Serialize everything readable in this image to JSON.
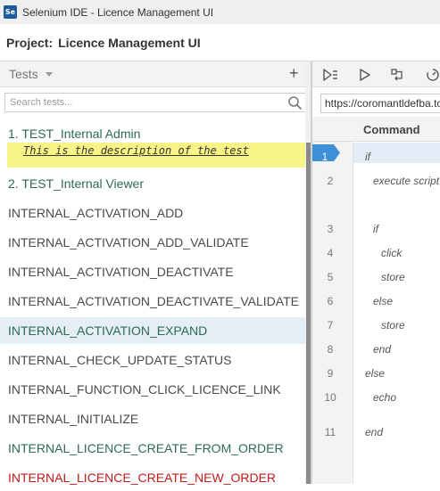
{
  "window": {
    "app_icon": "se-logo-icon",
    "logo_text": "Se",
    "title": "Selenium IDE - Licence Management UI"
  },
  "project": {
    "label": "Project:",
    "name": "Licence Management UI"
  },
  "tests_panel": {
    "title": "Tests",
    "add_label": "+",
    "search_placeholder": "Search tests...",
    "description": "This is the description of the test",
    "items": [
      {
        "label": "1. TEST_Internal Admin",
        "color": "#2c6b52"
      },
      {
        "label": "2. TEST_Internal Viewer",
        "color": "#2c6b52"
      },
      {
        "label": "INTERNAL_ACTIVATION_ADD",
        "color": "#4a4a4a"
      },
      {
        "label": "INTERNAL_ACTIVATION_ADD_VALIDATE",
        "color": "#4a4a4a"
      },
      {
        "label": "INTERNAL_ACTIVATION_DEACTIVATE",
        "color": "#4a4a4a"
      },
      {
        "label": "INTERNAL_ACTIVATION_DEACTIVATE_VALIDATE",
        "color": "#4a4a4a"
      },
      {
        "label": "INTERNAL_ACTIVATION_EXPAND",
        "color": "#2c6b52",
        "selected": true
      },
      {
        "label": "INTERNAL_CHECK_UPDATE_STATUS",
        "color": "#4a4a4a"
      },
      {
        "label": "INTERNAL_FUNCTION_CLICK_LICENCE_LINK",
        "color": "#4a4a4a"
      },
      {
        "label": "INTERNAL_INITIALIZE",
        "color": "#4a4a4a"
      },
      {
        "label": "INTERNAL_LICENCE_CREATE_FROM_ORDER",
        "color": "#2c6b52"
      },
      {
        "label": "INTERNAL_LICENCE_CREATE_NEW_ORDER",
        "color": "#c41a1a"
      }
    ]
  },
  "editor": {
    "toolbar_icons": [
      "run-all-icon",
      "run-icon",
      "step-icon",
      "speed-icon"
    ],
    "url": "https://coromantldefba.to",
    "command_header": "Command",
    "rows": [
      {
        "num": "1",
        "command": "if"
      },
      {
        "num": "2",
        "command": "execute script"
      },
      {
        "num": "3",
        "command": "if"
      },
      {
        "num": "4",
        "command": "click"
      },
      {
        "num": "5",
        "command": "store"
      },
      {
        "num": "6",
        "command": "else"
      },
      {
        "num": "7",
        "command": "store"
      },
      {
        "num": "8",
        "command": "end"
      },
      {
        "num": "9",
        "command": "else"
      },
      {
        "num": "10",
        "command": "echo"
      },
      {
        "num": "11",
        "command": "end"
      }
    ]
  },
  "colors": {
    "accent": "#3d8fd6",
    "selected_bg": "#e6eef5",
    "note_bg": "#f8f488"
  }
}
